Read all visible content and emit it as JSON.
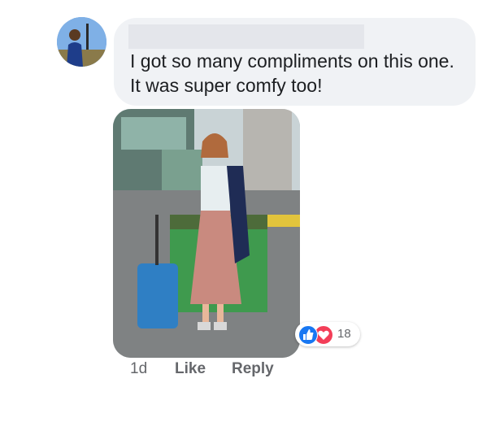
{
  "comment": {
    "author_name": "",
    "text": "I got so many compliments on this one. It was super comfy too!",
    "reactions": {
      "icons": [
        "like-icon",
        "love-icon"
      ],
      "count": "18"
    },
    "actions": {
      "time": "1d",
      "like_label": "Like",
      "reply_label": "Reply"
    }
  },
  "colors": {
    "bubble": "#f0f2f5",
    "like_blue": "#1877f2",
    "love_red": "#f33e58",
    "secondary_text": "#65676b"
  }
}
